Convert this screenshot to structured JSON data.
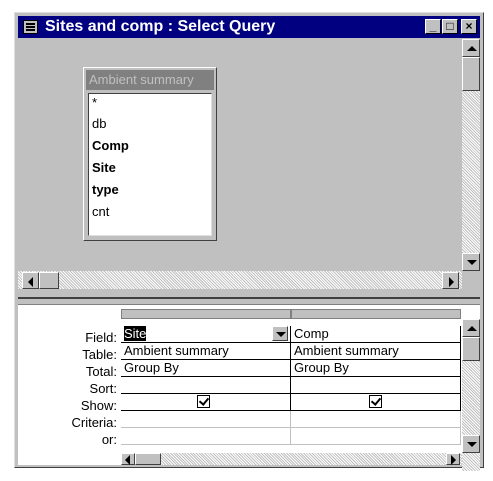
{
  "window": {
    "title": "Sites and comp : Select Query",
    "buttons": {
      "minimize": "_",
      "maximize": "□",
      "close": "×"
    }
  },
  "field_list": {
    "title": "Ambient summary",
    "items": [
      {
        "label": "*",
        "bold": false
      },
      {
        "label": "db",
        "bold": false
      },
      {
        "label": "Comp",
        "bold": true
      },
      {
        "label": "Site",
        "bold": true
      },
      {
        "label": "type",
        "bold": true
      },
      {
        "label": "cnt",
        "bold": false
      }
    ]
  },
  "grid": {
    "row_labels": {
      "field": "Field:",
      "table": "Table:",
      "total": "Total:",
      "sort": "Sort:",
      "show": "Show:",
      "criteria": "Criteria:",
      "or": "or:"
    },
    "columns": [
      {
        "field": "Site",
        "table": "Ambient summary",
        "total": "Group By",
        "sort": "",
        "show": true,
        "criteria": "",
        "or": ""
      },
      {
        "field": "Comp",
        "table": "Ambient summary",
        "total": "Group By",
        "sort": "",
        "show": true,
        "criteria": "",
        "or": ""
      }
    ]
  },
  "colors": {
    "title_bar": "#000080",
    "window_face": "#c0c0c0",
    "field_list_title": "#808080"
  },
  "icons": {
    "title_icon": "query-icon",
    "dropdown": "chevron-down-icon"
  }
}
